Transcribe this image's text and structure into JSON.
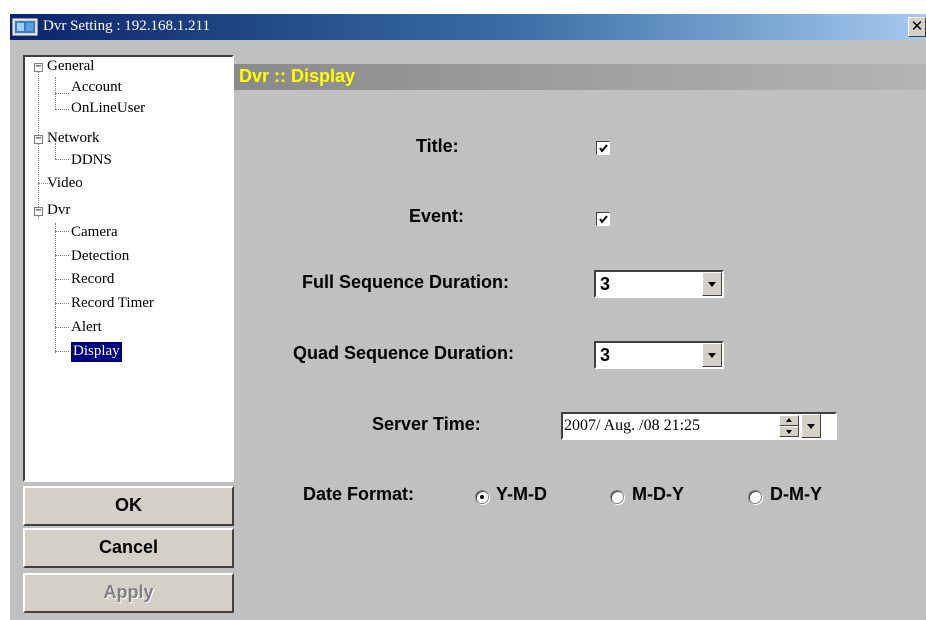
{
  "window": {
    "title": "Dvr Setting : 192.168.1.211",
    "close_symbol": "✕"
  },
  "tree": {
    "items": [
      {
        "label": "General"
      },
      {
        "label": "Account"
      },
      {
        "label": "OnLineUser"
      },
      {
        "label": "Network"
      },
      {
        "label": "DDNS"
      },
      {
        "label": "Video"
      },
      {
        "label": "Dvr"
      },
      {
        "label": "Camera"
      },
      {
        "label": "Detection"
      },
      {
        "label": "Record"
      },
      {
        "label": "Record Timer"
      },
      {
        "label": "Alert"
      },
      {
        "label": "Display"
      }
    ],
    "toggle_symbol": "−"
  },
  "buttons": {
    "ok": "OK",
    "cancel": "Cancel",
    "apply": "Apply"
  },
  "panel": {
    "header": "Dvr :: Display",
    "title_label": "Title:",
    "title_checked": true,
    "event_label": "Event:",
    "event_checked": true,
    "full_seq_label": "Full Sequence Duration:",
    "full_seq_value": "3",
    "quad_seq_label": "Quad Sequence Duration:",
    "quad_seq_value": "3",
    "server_time_label": "Server Time:",
    "server_time_value": "2007/  Aug.  /08 21:25",
    "date_format_label": "Date Format:",
    "date_format_options": [
      "Y-M-D",
      "M-D-Y",
      "D-M-Y"
    ],
    "date_format_selected": "Y-M-D"
  },
  "colors": {
    "title_bar": "#0a246a",
    "header_text": "#ffff00",
    "selection": "#000080",
    "window_bg": "#c0c0c0"
  }
}
